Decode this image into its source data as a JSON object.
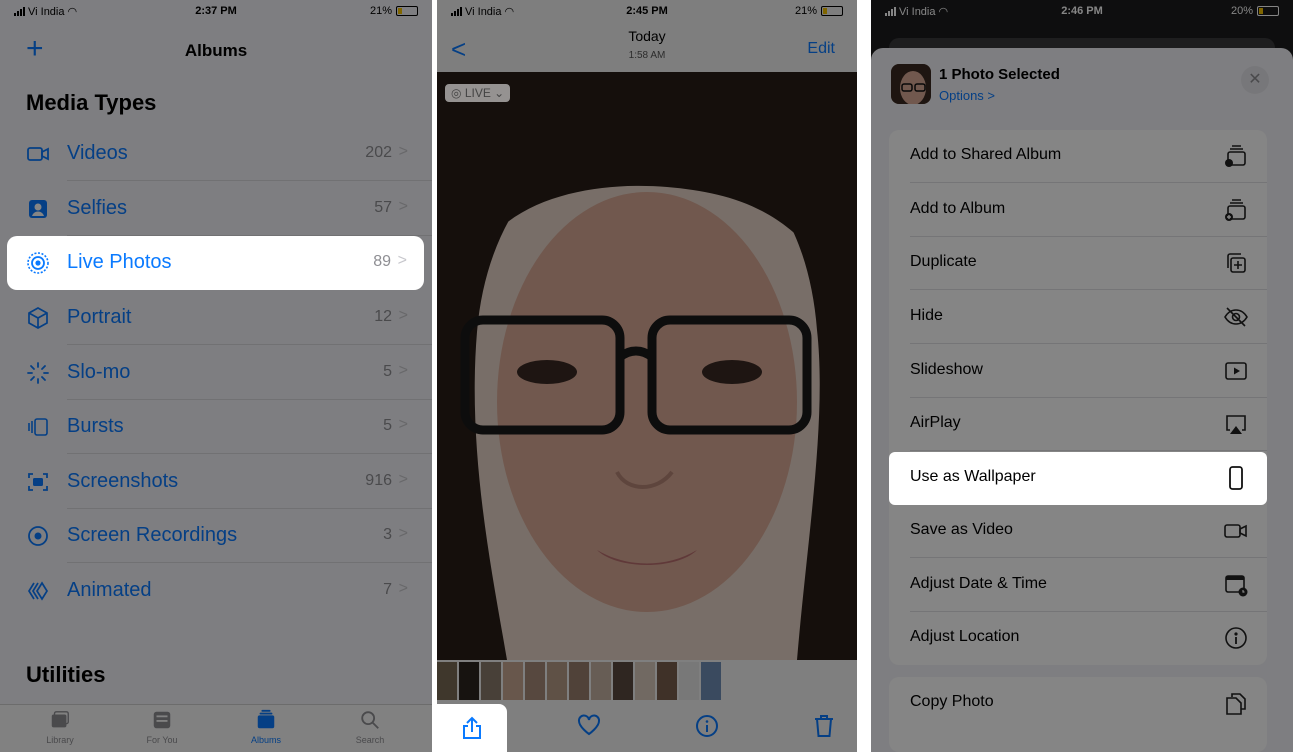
{
  "panel1": {
    "status": {
      "carrier": "Vi India",
      "time": "2:37 PM",
      "battery": "21%"
    },
    "nav": {
      "title": "Albums",
      "add_icon": "plus-icon"
    },
    "section_media": "Media Types",
    "items": [
      {
        "label": "Videos",
        "count": "202",
        "icon": "video-icon"
      },
      {
        "label": "Selfies",
        "count": "57",
        "icon": "selfie-icon"
      },
      {
        "label": "Live Photos",
        "count": "89",
        "icon": "live-photo-icon"
      },
      {
        "label": "Portrait",
        "count": "12",
        "icon": "portrait-cube-icon"
      },
      {
        "label": "Slo-mo",
        "count": "5",
        "icon": "slomo-icon"
      },
      {
        "label": "Bursts",
        "count": "5",
        "icon": "bursts-icon"
      },
      {
        "label": "Screenshots",
        "count": "916",
        "icon": "screenshot-icon"
      },
      {
        "label": "Screen Recordings",
        "count": "3",
        "icon": "screen-recording-icon"
      },
      {
        "label": "Animated",
        "count": "7",
        "icon": "animated-icon"
      }
    ],
    "chevron": ">",
    "section_utilities": "Utilities",
    "tabs": [
      {
        "label": "Library",
        "icon": "library-icon"
      },
      {
        "label": "For You",
        "icon": "for-you-icon"
      },
      {
        "label": "Albums",
        "icon": "albums-icon"
      },
      {
        "label": "Search",
        "icon": "search-icon"
      }
    ],
    "highlight_color": "#0a7aff"
  },
  "panel2": {
    "status": {
      "carrier": "Vi India",
      "time": "2:45 PM",
      "battery": "21%"
    },
    "nav": {
      "date": "Today",
      "time": "1:58 AM",
      "edit": "Edit",
      "back": "<"
    },
    "live_badge": "LIVE",
    "toolbar": [
      "share-icon",
      "heart-icon",
      "info-icon",
      "trash-icon"
    ]
  },
  "panel3": {
    "status": {
      "carrier": "Vi India",
      "time": "2:46 PM",
      "battery": "20%"
    },
    "header": {
      "title": "1 Photo Selected",
      "options": "Options >",
      "close": "✕"
    },
    "actions": [
      {
        "label": "Add to Shared Album",
        "icon": "shared-album-icon"
      },
      {
        "label": "Add to Album",
        "icon": "add-album-icon"
      },
      {
        "label": "Duplicate",
        "icon": "duplicate-icon"
      },
      {
        "label": "Hide",
        "icon": "hide-eye-icon"
      },
      {
        "label": "Slideshow",
        "icon": "slideshow-play-icon"
      },
      {
        "label": "AirPlay",
        "icon": "airplay-icon"
      },
      {
        "label": "Use as Wallpaper",
        "icon": "phone-wallpaper-icon"
      },
      {
        "label": "Save as Video",
        "icon": "video-icon"
      },
      {
        "label": "Adjust Date & Time",
        "icon": "calendar-clock-icon"
      },
      {
        "label": "Adjust Location",
        "icon": "location-info-icon"
      }
    ],
    "secondary": [
      {
        "label": "Copy Photo",
        "icon": "copy-icon"
      }
    ]
  }
}
